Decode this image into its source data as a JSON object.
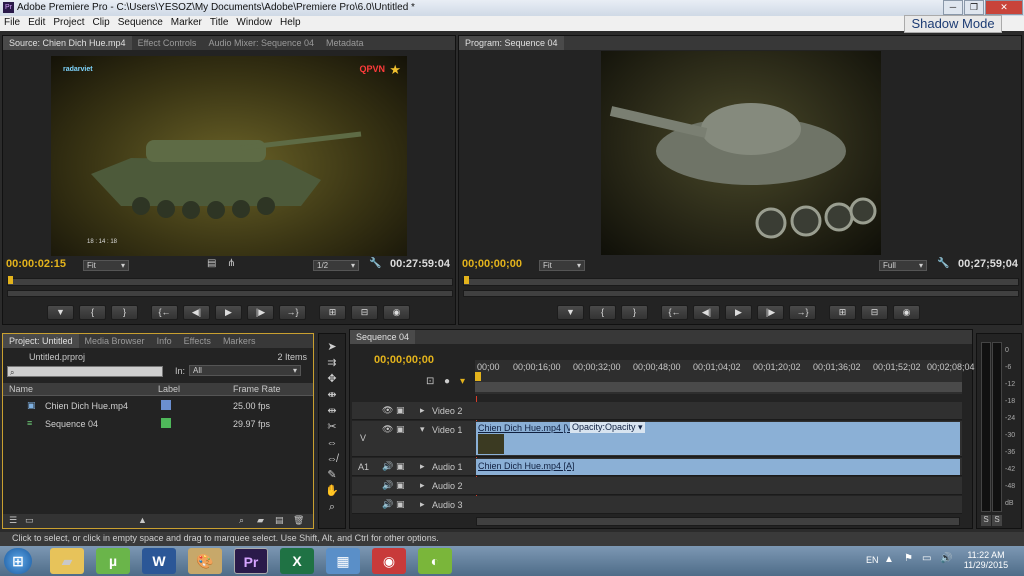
{
  "window": {
    "title": "Adobe Premiere Pro - C:\\Users\\YESOZ\\My Documents\\Adobe\\Premiere Pro\\6.0\\Untitled *",
    "minimize": "─",
    "restore": "❐",
    "close": "✕"
  },
  "menu": [
    "File",
    "Edit",
    "Project",
    "Clip",
    "Sequence",
    "Marker",
    "Title",
    "Window",
    "Help"
  ],
  "shadow_mode": "Shadow Mode",
  "source": {
    "tabs": [
      "Source: Chien Dich Hue.mp4",
      "Effect Controls",
      "Audio Mixer: Sequence 04",
      "Metadata"
    ],
    "overlay_left": "radarviet",
    "overlay_right": "QPVN",
    "overlay_time": "18 : 14 : 18",
    "timecode": "00:00:02:15",
    "fit": "Fit",
    "ratio": "1/2",
    "duration": "00:27:59:04"
  },
  "program": {
    "tab": "Program: Sequence 04",
    "timecode": "00;00;00;00",
    "fit": "Fit",
    "quality": "Full",
    "duration": "00;27;59;04"
  },
  "transport_icons": [
    "▼",
    "{",
    "}",
    "{←",
    "◀|",
    "▶",
    "|▶",
    "→}",
    "⊞",
    "⊟",
    "◉"
  ],
  "project": {
    "tabs": [
      "Project: Untitled",
      "Media Browser",
      "Info",
      "Effects",
      "Markers"
    ],
    "file": "Untitled.prproj",
    "count": "2 Items",
    "search_placeholder": "",
    "in_label": "In:",
    "in_value": "All",
    "columns": [
      "Name",
      "Label",
      "Frame Rate"
    ],
    "rows": [
      {
        "name": "Chien Dich Hue.mp4",
        "rate": "25.00 fps",
        "color": "#6b8fd0"
      },
      {
        "name": "Sequence 04",
        "rate": "29.97 fps",
        "color": "#4fb85a"
      }
    ]
  },
  "timeline": {
    "tab": "Sequence 04",
    "timecode": "00;00;00;00",
    "ruler": [
      "00;00",
      "00;00;16;00",
      "00;00;32;00",
      "00;00;48;00",
      "00;01;04;02",
      "00;01;20;02",
      "00;01;36;02",
      "00;01;52;02",
      "00;02;08;04"
    ],
    "tracks": [
      {
        "id": "",
        "name": "Video 2"
      },
      {
        "id": "V",
        "name": "Video 1"
      },
      {
        "id": "A1",
        "name": "Audio 1"
      },
      {
        "id": "",
        "name": "Audio 2"
      },
      {
        "id": "",
        "name": "Audio 3"
      }
    ],
    "video_clip": "Chien Dich Hue.mp4 [V]",
    "opacity": "Opacity:Opacity",
    "audio_clip": "Chien Dich Hue.mp4 [A]"
  },
  "meter": {
    "labels": [
      "0",
      "-6",
      "-12",
      "-18",
      "-24",
      "-30",
      "-36",
      "-42",
      "-48",
      "dB"
    ],
    "solo": "S"
  },
  "status": "Click to select, or click in empty space and drag to marquee select. Use Shift, Alt, and Ctrl for other options.",
  "taskbar": {
    "lang": "EN",
    "time": "11:22 AM",
    "date": "11/29/2015",
    "apps": [
      "W",
      "Pr",
      "X"
    ]
  }
}
